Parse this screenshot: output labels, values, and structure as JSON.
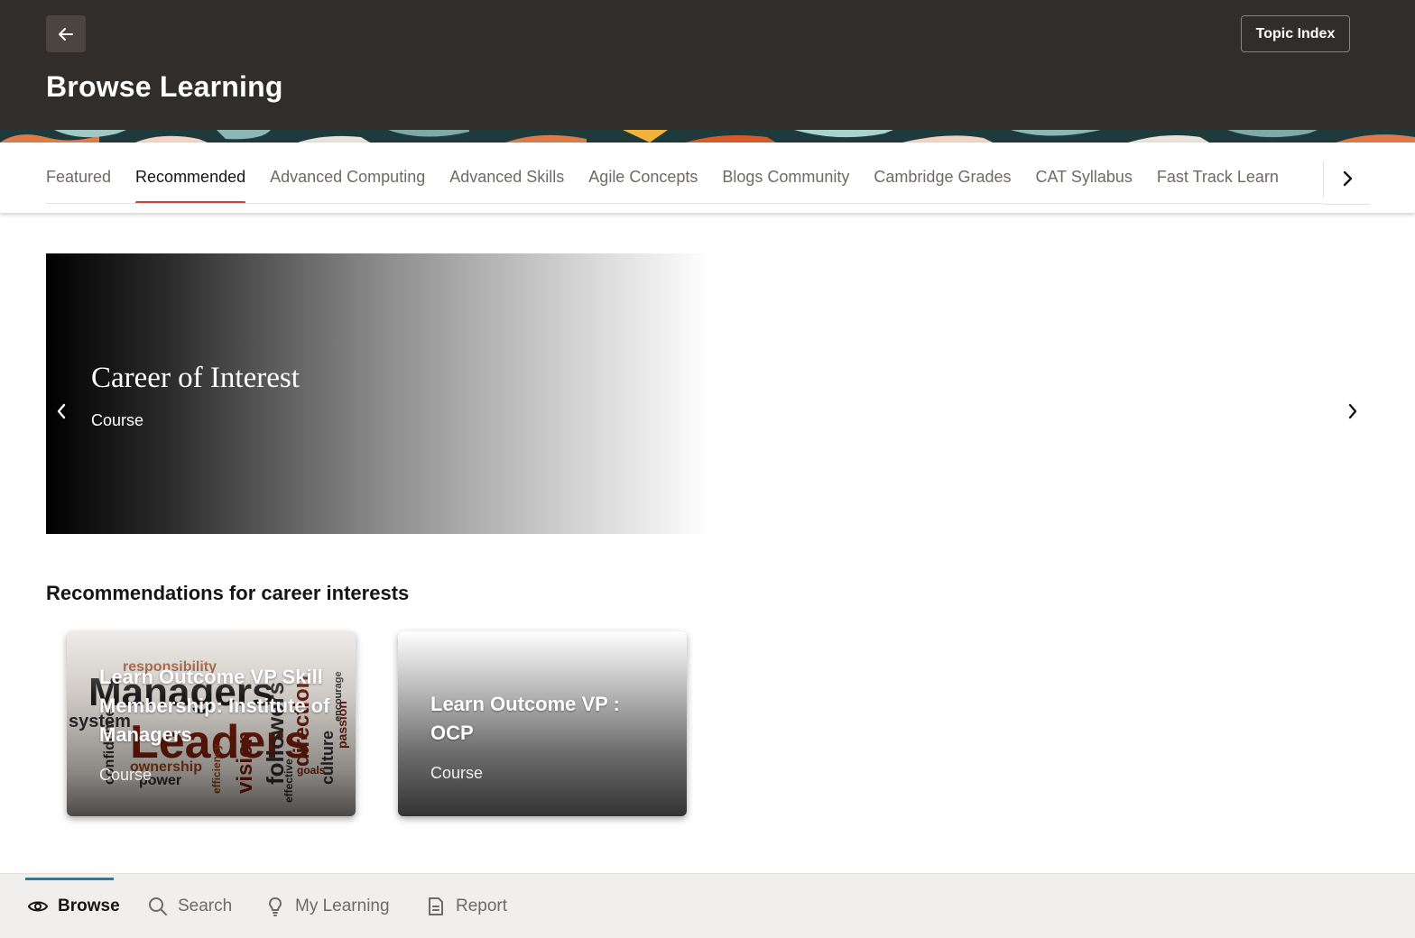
{
  "header": {
    "title": "Browse Learning",
    "back_icon": "arrow-left-icon",
    "topic_index_label": "Topic Index",
    "colors": {
      "background": "#312d2a"
    }
  },
  "tabs": {
    "items": [
      {
        "label": "Featured",
        "active": false
      },
      {
        "label": "Recommended",
        "active": true
      },
      {
        "label": "Advanced Computing",
        "active": false
      },
      {
        "label": "Advanced Skills",
        "active": false
      },
      {
        "label": "Agile Concepts",
        "active": false
      },
      {
        "label": "Blogs Community",
        "active": false
      },
      {
        "label": "Cambridge Grades",
        "active": false
      },
      {
        "label": "CAT Syllabus",
        "active": false
      },
      {
        "label": "Fast Track Learn",
        "active": false
      }
    ],
    "next_icon": "chevron-right-icon",
    "accent_color": "#c74634"
  },
  "carousel": {
    "title": "Career of Interest",
    "type": "Course",
    "prev_icon": "chevron-left-icon",
    "next_icon": "chevron-right-icon"
  },
  "recommendations": {
    "heading": "Recommendations for career interests",
    "cards": [
      {
        "title": "Learn Outcome VP Skill Membership: Institute of Managers",
        "type": "Course"
      },
      {
        "title": "Learn Outcome VP : OCP",
        "type": "Course"
      }
    ]
  },
  "bottom_nav": {
    "items": [
      {
        "label": "Browse",
        "icon": "eye-icon",
        "active": true
      },
      {
        "label": "Search",
        "icon": "search-icon",
        "active": false
      },
      {
        "label": "My Learning",
        "icon": "lightbulb-icon",
        "active": false
      },
      {
        "label": "Report",
        "icon": "report-icon",
        "active": false
      }
    ],
    "indicator_color": "#227e9e"
  }
}
